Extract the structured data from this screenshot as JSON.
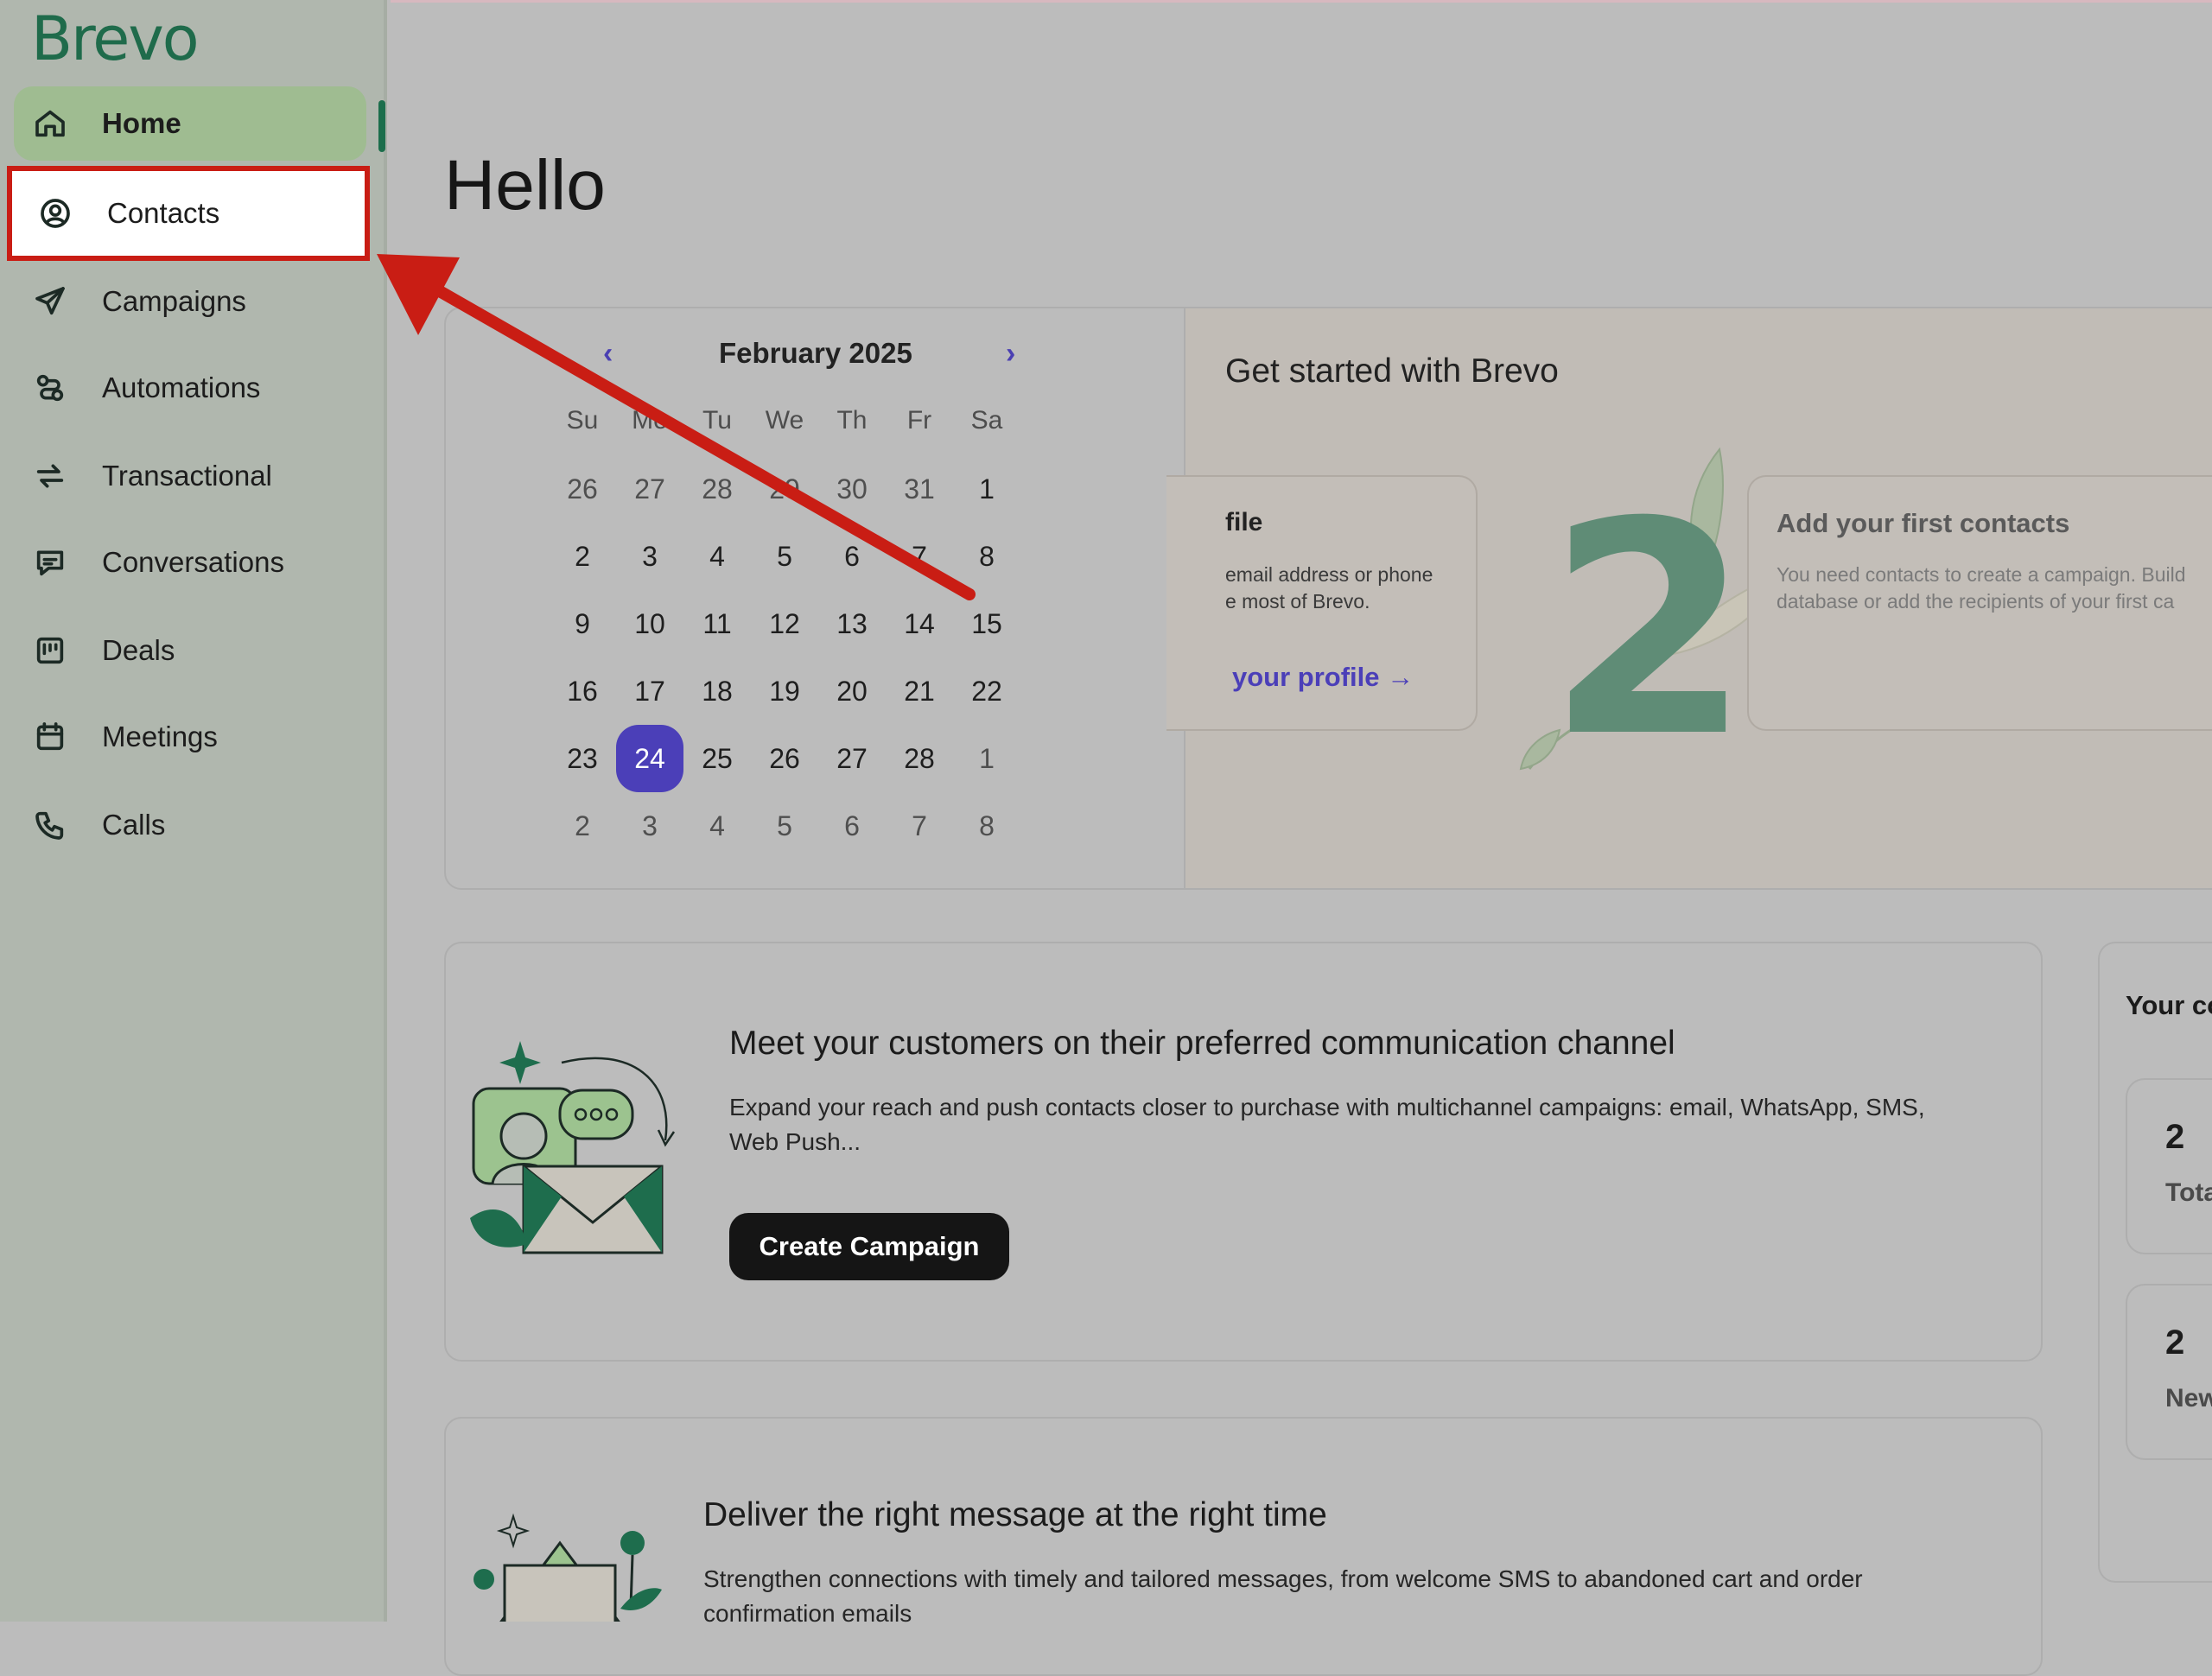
{
  "brand": {
    "logo": "Brevo"
  },
  "sidebar": {
    "items": [
      {
        "label": "Home",
        "icon": "home-icon"
      },
      {
        "label": "Contacts",
        "icon": "contacts-icon"
      },
      {
        "label": "Campaigns",
        "icon": "send-icon"
      },
      {
        "label": "Automations",
        "icon": "automations-icon"
      },
      {
        "label": "Transactional",
        "icon": "transactional-icon"
      },
      {
        "label": "Conversations",
        "icon": "conversations-icon"
      },
      {
        "label": "Deals",
        "icon": "deals-icon"
      },
      {
        "label": "Meetings",
        "icon": "calendar-icon"
      },
      {
        "label": "Calls",
        "icon": "phone-icon"
      }
    ]
  },
  "main": {
    "greeting": "Hello"
  },
  "calendar": {
    "month_label": "February 2025",
    "prev": "‹",
    "next": "›",
    "weekdays": [
      "Su",
      "Mo",
      "Tu",
      "We",
      "Th",
      "Fr",
      "Sa"
    ],
    "weeks": [
      [
        "26",
        "27",
        "28",
        "29",
        "30",
        "31",
        "1"
      ],
      [
        "2",
        "3",
        "4",
        "5",
        "6",
        "7",
        "8"
      ],
      [
        "9",
        "10",
        "11",
        "12",
        "13",
        "14",
        "15"
      ],
      [
        "16",
        "17",
        "18",
        "19",
        "20",
        "21",
        "22"
      ],
      [
        "23",
        "24",
        "25",
        "26",
        "27",
        "28",
        "1"
      ],
      [
        "2",
        "3",
        "4",
        "5",
        "6",
        "7",
        "8"
      ]
    ],
    "selected": "24",
    "accent": "#4b3fb8"
  },
  "get_started": {
    "title": "Get started with Brevo",
    "profile_card": {
      "title": "file",
      "line1": "email address or phone",
      "line2": "e most of Brevo.",
      "link": "your profile →"
    },
    "step_number": "2",
    "contacts_card": {
      "title": "Add your first contacts",
      "line1": "You need contacts to create a campaign. Build",
      "line2": "database or add the recipients of your first ca"
    }
  },
  "promo1": {
    "title": "Meet your customers on their preferred communication channel",
    "text_line1": "Expand your reach and push contacts closer to purchase with multichannel campaigns: email, WhatsApp, SMS,",
    "text_line2": "Web Push...",
    "button": "Create Campaign"
  },
  "promo2": {
    "title": "Deliver the right message at the right time",
    "text_line1": "Strengthen connections with timely and tailored messages, from welcome SMS to abandoned cart and order",
    "text_line2": "confirmation emails"
  },
  "side_panel": {
    "title": "Your co",
    "stats": [
      {
        "value": "2",
        "label": "Tota"
      },
      {
        "value": "2",
        "label": "New"
      }
    ]
  },
  "annotation_color": "#c91d14"
}
